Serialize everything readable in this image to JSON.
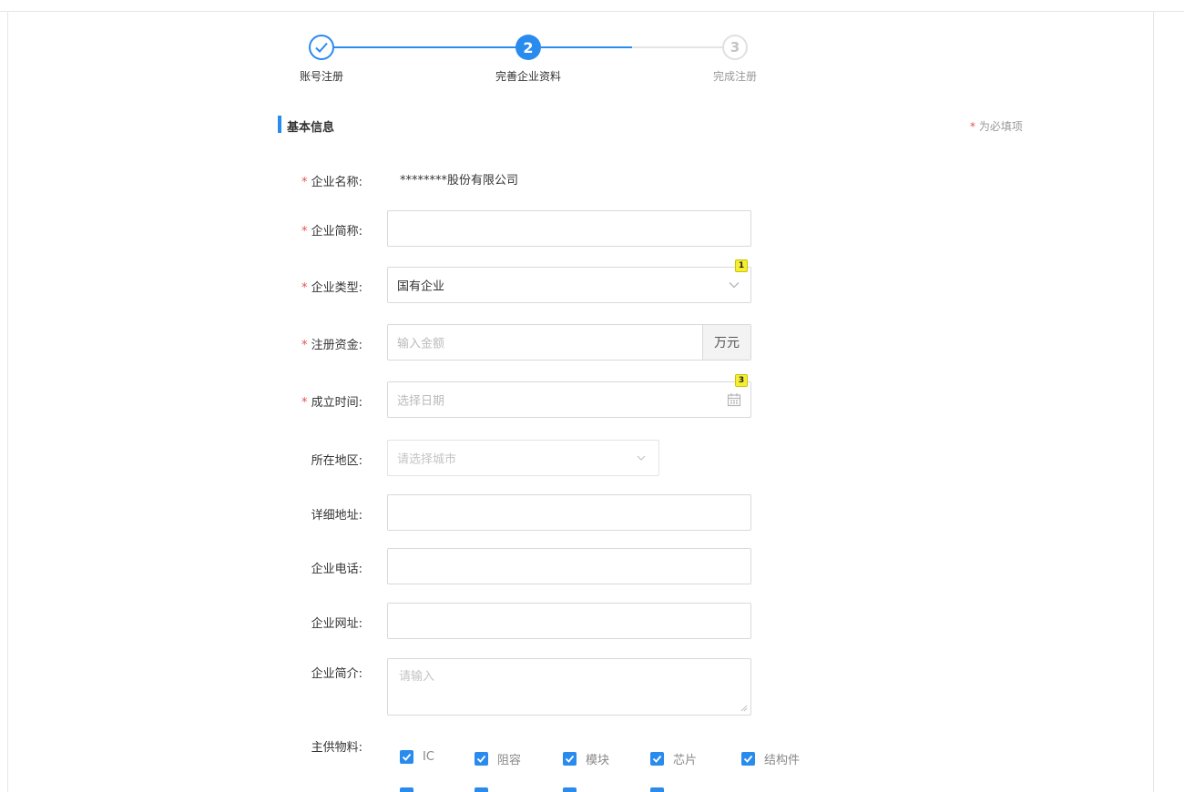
{
  "steps": [
    {
      "label": "账号注册",
      "state": "done"
    },
    {
      "label": "完善企业资料",
      "number": "2",
      "state": "active"
    },
    {
      "label": "完成注册",
      "number": "3",
      "state": "pending"
    }
  ],
  "section": {
    "title": "基本信息",
    "required_star": "*",
    "required_note": "为必填项"
  },
  "form": {
    "company_name": {
      "star": "*",
      "label": "企业名称:",
      "value": "********股份有限公司"
    },
    "short_name": {
      "star": "*",
      "label": "企业简称:",
      "value": ""
    },
    "company_type": {
      "star": "*",
      "label": "企业类型:",
      "value": "国有企业",
      "badge": "1"
    },
    "capital": {
      "star": "*",
      "label": "注册资金:",
      "placeholder": "输入金额",
      "suffix": "万元"
    },
    "founded": {
      "star": "*",
      "label": "成立时间:",
      "placeholder": "选择日期",
      "badge": "3"
    },
    "region": {
      "label": "所在地区:",
      "placeholder": "请选择城市"
    },
    "address": {
      "label": "详细地址:",
      "value": ""
    },
    "phone": {
      "label": "企业电话:",
      "value": ""
    },
    "website": {
      "label": "企业网址:",
      "value": ""
    },
    "intro": {
      "label": "企业简介:",
      "placeholder": "请输入"
    },
    "materials": {
      "label": "主供物料:",
      "options": [
        "IC",
        "阻容",
        "模块",
        "芯片",
        "结构件"
      ]
    }
  },
  "colors": {
    "accent": "#2a8bee",
    "required": "#e8504c",
    "badge": "#f5ee32"
  }
}
